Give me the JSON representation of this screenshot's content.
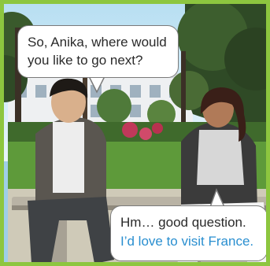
{
  "dialogue": {
    "speaker_1": {
      "line_1": "So, Anika, where would",
      "line_2": "you like to go next?"
    },
    "speaker_2": {
      "line_1": "Hm… good question.",
      "line_2": "I’d love to visit France."
    }
  },
  "colors": {
    "frame_border": "#8dc63f",
    "highlight_text": "#2a8fd0"
  }
}
